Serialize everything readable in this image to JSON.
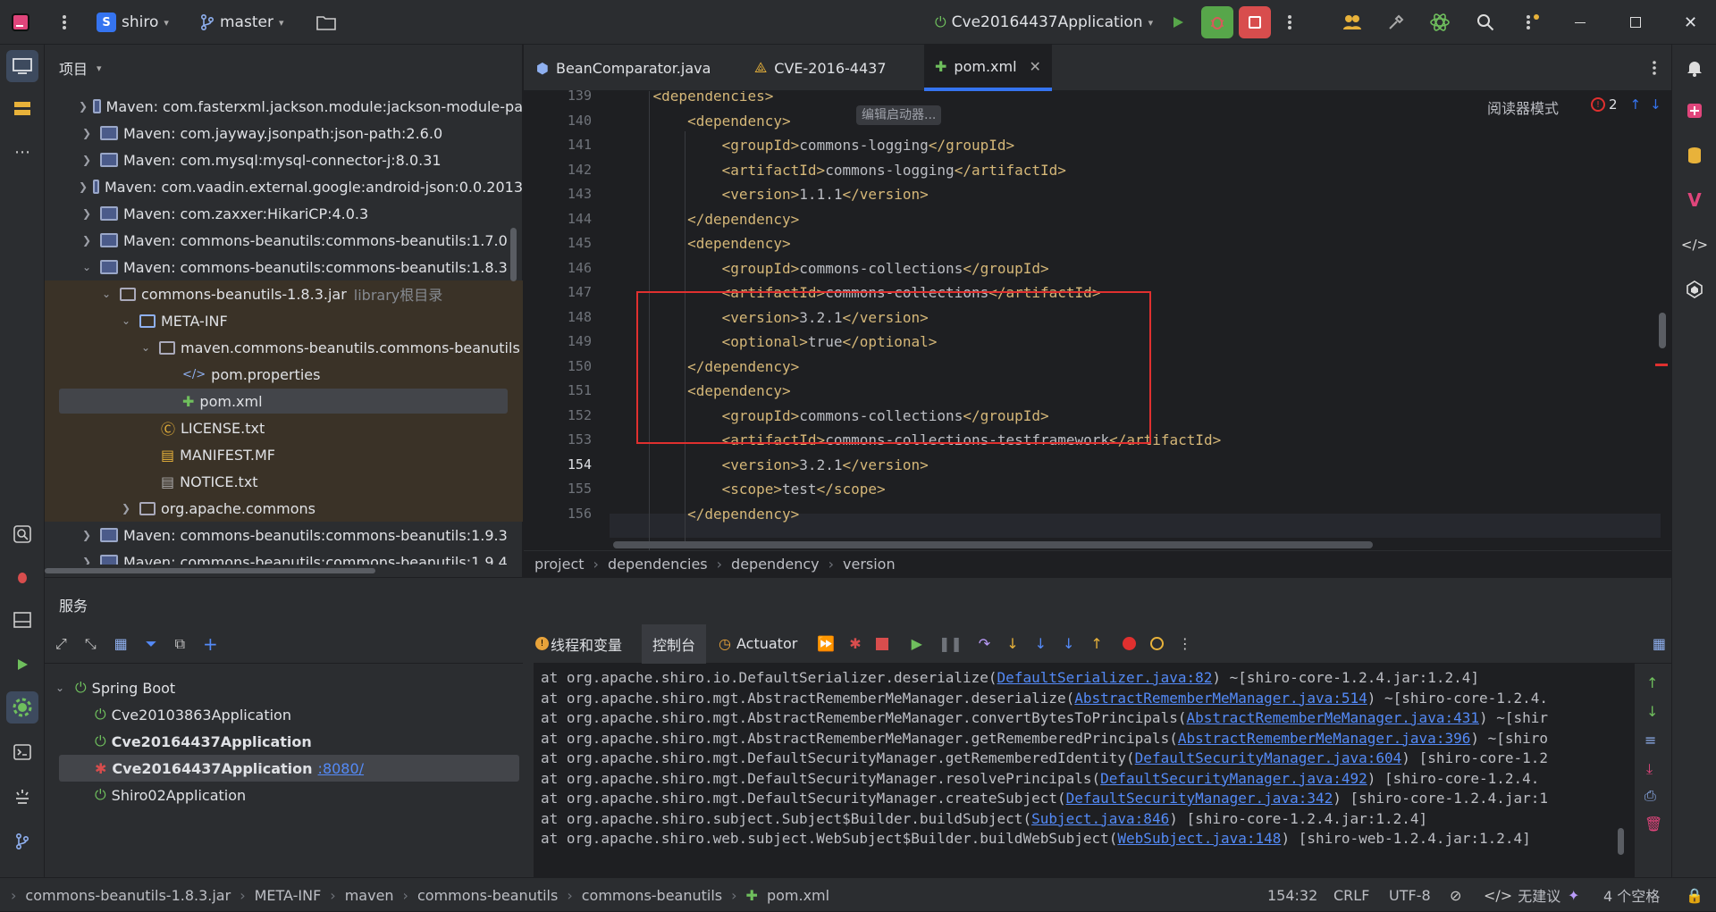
{
  "titlebar": {
    "project_badge": "S",
    "project_name": "shiro",
    "branch": "master",
    "run_config": "Cve20164437Application"
  },
  "project_panel": {
    "title": "项目",
    "rows": [
      {
        "label": "Maven: com.fasterxml.jackson.module:jackson-module-pa",
        "hint": ""
      },
      {
        "label": "Maven: com.jayway.jsonpath:json-path:2.6.0",
        "hint": ""
      },
      {
        "label": "Maven: com.mysql:mysql-connector-j:8.0.31",
        "hint": ""
      },
      {
        "label": "Maven: com.vaadin.external.google:android-json:0.0.2013",
        "hint": ""
      },
      {
        "label": "Maven: com.zaxxer:HikariCP:4.0.3",
        "hint": ""
      },
      {
        "label": "Maven: commons-beanutils:commons-beanutils:1.7.0",
        "hint": ""
      },
      {
        "label": "Maven: commons-beanutils:commons-beanutils:1.8.3",
        "hint": ""
      },
      {
        "label": "commons-beanutils-1.8.3.jar",
        "hint": "library根目录"
      },
      {
        "label": "META-INF",
        "hint": ""
      },
      {
        "label": "maven.commons-beanutils.commons-beanutils",
        "hint": ""
      },
      {
        "label": "pom.properties",
        "hint": ""
      },
      {
        "label": "pom.xml",
        "hint": ""
      },
      {
        "label": "LICENSE.txt",
        "hint": ""
      },
      {
        "label": "MANIFEST.MF",
        "hint": ""
      },
      {
        "label": "NOTICE.txt",
        "hint": ""
      },
      {
        "label": "org.apache.commons",
        "hint": ""
      },
      {
        "label": "Maven: commons-beanutils:commons-beanutils:1.9.3",
        "hint": ""
      },
      {
        "label": "Maven: commons-beanutils:commons-beanutils:1.9.4",
        "hint": ""
      }
    ]
  },
  "editor": {
    "tabs": [
      "BeanComparator.java",
      "CVE-2016-4437",
      "pom.xml"
    ],
    "reader_mode": "阅读器模式",
    "problems_count": "2",
    "inlay_hint": "编辑启动器...",
    "lines": [
      {
        "num": "139",
        "text": "    <dependencies>"
      },
      {
        "num": "140",
        "text": "        <dependency>"
      },
      {
        "num": "141",
        "text": "            <groupId>commons-logging</groupId>"
      },
      {
        "num": "142",
        "text": "            <artifactId>commons-logging</artifactId>"
      },
      {
        "num": "143",
        "text": "            <version>1.1.1</version>"
      },
      {
        "num": "144",
        "text": "        </dependency>"
      },
      {
        "num": "145",
        "text": "        <dependency>"
      },
      {
        "num": "146",
        "text": "            <groupId>commons-collections</groupId>"
      },
      {
        "num": "147",
        "text": "            <artifactId>commons-collections</artifactId>"
      },
      {
        "num": "148",
        "text": "            <version>3.2.1</version>"
      },
      {
        "num": "149",
        "text": "            <optional>true</optional>"
      },
      {
        "num": "150",
        "text": "        </dependency>"
      },
      {
        "num": "151",
        "text": "        <dependency>"
      },
      {
        "num": "152",
        "text": "            <groupId>commons-collections</groupId>"
      },
      {
        "num": "153",
        "text": "            <artifactId>commons-collections-testframework</artifactId>"
      },
      {
        "num": "154",
        "text": "            <version>3.2.1</version>"
      },
      {
        "num": "155",
        "text": "            <scope>test</scope>"
      },
      {
        "num": "156",
        "text": "        </dependency>"
      }
    ],
    "breadcrumb": [
      "project",
      "dependencies",
      "dependency",
      "version"
    ]
  },
  "services": {
    "title": "服务",
    "toolbar": {
      "threads": "线程和变量",
      "console": "控制台",
      "actuator": "Actuator"
    },
    "tree": {
      "root": "Spring Boot",
      "apps": [
        {
          "name": "Cve20103863Application",
          "port": ""
        },
        {
          "name": "Cve20164437Application",
          "port": ""
        },
        {
          "name": "Cve20164437Application",
          "port": ":8080/"
        },
        {
          "name": "Shiro02Application",
          "port": ""
        }
      ]
    },
    "console_lines": [
      {
        "pre": "    at org.apache.shiro.io.DefaultSerializer.deserialize(",
        "link": "DefaultSerializer.java:82",
        "post": ") ~[shiro-core-1.2.4.jar:1.2.4]"
      },
      {
        "pre": "    at org.apache.shiro.mgt.AbstractRememberMeManager.deserialize(",
        "link": "AbstractRememberMeManager.java:514",
        "post": ") ~[shiro-core-1.2.4."
      },
      {
        "pre": "    at org.apache.shiro.mgt.AbstractRememberMeManager.convertBytesToPrincipals(",
        "link": "AbstractRememberMeManager.java:431",
        "post": ") ~[shir"
      },
      {
        "pre": "    at org.apache.shiro.mgt.AbstractRememberMeManager.getRememberedPrincipals(",
        "link": "AbstractRememberMeManager.java:396",
        "post": ") ~[shiro"
      },
      {
        "pre": "    at org.apache.shiro.mgt.DefaultSecurityManager.getRememberedIdentity(",
        "link": "DefaultSecurityManager.java:604",
        "post": ") [shiro-core-1.2"
      },
      {
        "pre": "    at org.apache.shiro.mgt.DefaultSecurityManager.resolvePrincipals(",
        "link": "DefaultSecurityManager.java:492",
        "post": ") [shiro-core-1.2.4."
      },
      {
        "pre": "    at org.apache.shiro.mgt.DefaultSecurityManager.createSubject(",
        "link": "DefaultSecurityManager.java:342",
        "post": ") [shiro-core-1.2.4.jar:1"
      },
      {
        "pre": "    at org.apache.shiro.subject.Subject$Builder.buildSubject(",
        "link": "Subject.java:846",
        "post": ") [shiro-core-1.2.4.jar:1.2.4]"
      },
      {
        "pre": "    at org.apache.shiro.web.subject.WebSubject$Builder.buildWebSubject(",
        "link": "WebSubject.java:148",
        "post": ") [shiro-web-1.2.4.jar:1.2.4]"
      }
    ]
  },
  "statusbar": {
    "path": [
      "commons-beanutils-1.8.3.jar",
      "META-INF",
      "maven",
      "commons-beanutils",
      "commons-beanutils",
      "pom.xml"
    ],
    "position": "154:32",
    "line_sep": "CRLF",
    "encoding": "UTF-8",
    "suggestion": "无建议",
    "indent": "4 个空格"
  },
  "colors": {
    "accent": "#3574f0",
    "highlight_box": "#e0302f",
    "xml_tag": "#d5b778",
    "link": "#548af7"
  }
}
